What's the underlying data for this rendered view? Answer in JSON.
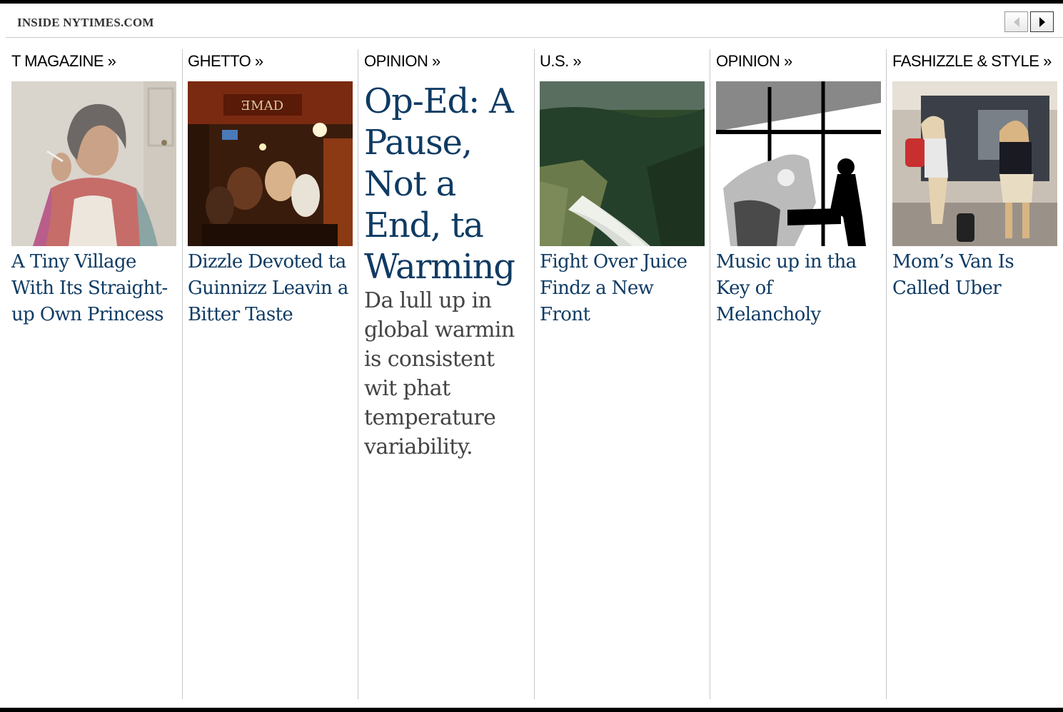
{
  "header": {
    "title": "INSIDE NYTIMES.COM",
    "prev_icon": "triangle-left-icon",
    "next_icon": "triangle-right-icon"
  },
  "columns": [
    {
      "kicker": "T MAGAZINE »",
      "headline": "A Tiny Village With Its Straight-up Own Princess"
    },
    {
      "kicker": "GHETTO »",
      "headline": "Dizzle Devoted ta Guinnizz Leavin a Bitter Taste"
    },
    {
      "kicker": "OPINION »",
      "headline": "Op-Ed: A Pause, Not a End, ta Warming",
      "summary": "Da lull up in global warmin is consistent wit phat temperature variability."
    },
    {
      "kicker": "U.S. »",
      "headline": "Fight Over Juice Findz a New Front"
    },
    {
      "kicker": "OPINION »",
      "headline": "Music up in tha Key of Melancholy"
    },
    {
      "kicker": "FASHIZZLE & STYLE »",
      "headline": "Mom’s Van Is Called Uber"
    }
  ],
  "colors": {
    "headline": "#0f3b63",
    "rule": "#000000",
    "divider": "#c9c9c9"
  }
}
